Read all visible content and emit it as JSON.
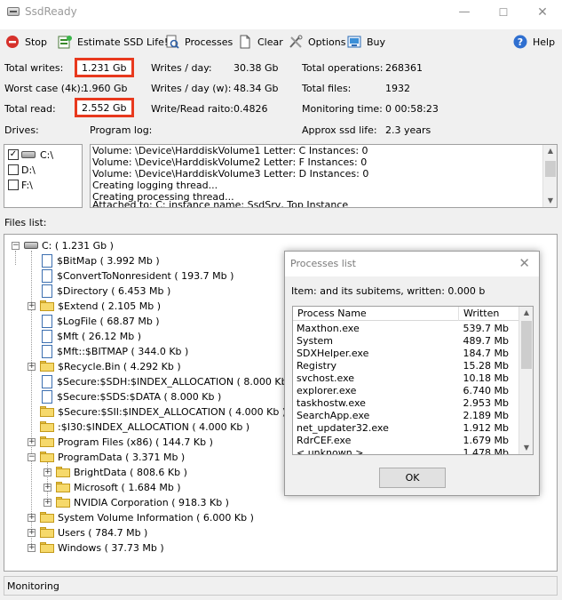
{
  "window": {
    "title": "SsdReady",
    "minimize": "—",
    "maximize": "☐",
    "close": "✕"
  },
  "toolbar": {
    "stop": "Stop",
    "estimate": "Estimate SSD Life!",
    "processes": "Processes",
    "clear": "Clear",
    "options": "Options",
    "buy": "Buy",
    "help": "Help"
  },
  "stats": {
    "total_writes_label": "Total writes:",
    "total_writes": "1.231 Gb",
    "worst_case_label": "Worst case (4k):",
    "worst_case": "1.960 Gb",
    "total_read_label": "Total read:",
    "total_read": "2.552 Gb",
    "writes_day_label": "Writes / day:",
    "writes_day": "30.38 Gb",
    "writes_day_w_label": "Writes / day (w):",
    "writes_day_w": "48.34 Gb",
    "ratio_label": "Write/Read raito:",
    "ratio": "0.4826",
    "total_ops_label": "Total operations:",
    "total_ops": "268361",
    "total_files_label": "Total files:",
    "total_files": "1932",
    "monitoring_time_label": "Monitoring time:",
    "monitoring_time": "0 00:58:23",
    "ssd_life_label": "Approx ssd life:",
    "ssd_life": "2.3 years"
  },
  "drives": {
    "label": "Drives:",
    "items": [
      {
        "name": "C:\\",
        "checked": "✓"
      },
      {
        "name": "D:\\",
        "checked": ""
      },
      {
        "name": "F:\\",
        "checked": ""
      }
    ]
  },
  "log": {
    "label": "Program log:",
    "lines": [
      "Volume: \\Device\\HarddiskVolume1 Letter: C Instances: 0",
      "Volume: \\Device\\HarddiskVolume2 Letter: F Instances: 0",
      "Volume: \\Device\\HarddiskVolume3 Letter: D Instances: 0",
      "Creating logging thread...",
      "Creating processing thread...",
      "Attached to: C: instance name: SsdSrv, Top Instance"
    ]
  },
  "files": {
    "label": "Files list:",
    "items": [
      {
        "text": "C: ( 1.231 Gb )"
      },
      {
        "text": "$BitMap ( 3.992 Mb )"
      },
      {
        "text": "$ConvertToNonresident ( 193.7 Mb )"
      },
      {
        "text": "$Directory ( 6.453 Mb )"
      },
      {
        "text": "$Extend ( 2.105 Mb )"
      },
      {
        "text": "$LogFile ( 68.87 Mb )"
      },
      {
        "text": "$Mft ( 26.12 Mb )"
      },
      {
        "text": "$Mft::$BITMAP ( 344.0 Kb )"
      },
      {
        "text": "$Recycle.Bin ( 4.292 Kb )"
      },
      {
        "text": "$Secure:$SDH:$INDEX_ALLOCATION ( 8.000 Kb )"
      },
      {
        "text": "$Secure:$SDS:$DATA ( 8.000 Kb )"
      },
      {
        "text": "$Secure:$SII:$INDEX_ALLOCATION ( 4.000 Kb )"
      },
      {
        "text": ":$I30:$INDEX_ALLOCATION ( 4.000 Kb )"
      },
      {
        "text": "Program Files (x86) ( 144.7 Kb )"
      },
      {
        "text": "ProgramData ( 3.371 Mb )"
      },
      {
        "text": "BrightData ( 808.6 Kb )"
      },
      {
        "text": "Microsoft ( 1.684 Mb )"
      },
      {
        "text": "NVIDIA Corporation ( 918.3 Kb )"
      },
      {
        "text": "System Volume Information ( 6.000 Kb )"
      },
      {
        "text": "Users ( 784.7 Mb )"
      },
      {
        "text": "Windows ( 37.73 Mb )"
      }
    ]
  },
  "status": {
    "text": "Monitoring"
  },
  "dialog": {
    "title": "Processes list",
    "close": "✕",
    "item_info": "Item:  and its subitems, written: 0.000 b",
    "col_name": "Process Name",
    "col_written": "Written",
    "rows": [
      {
        "name": "Maxthon.exe",
        "written": "539.7 Mb"
      },
      {
        "name": "System",
        "written": "489.7 Mb"
      },
      {
        "name": "SDXHelper.exe",
        "written": "184.7 Mb"
      },
      {
        "name": "Registry",
        "written": "15.28 Mb"
      },
      {
        "name": "svchost.exe",
        "written": "10.18 Mb"
      },
      {
        "name": "explorer.exe",
        "written": "6.740 Mb"
      },
      {
        "name": "taskhostw.exe",
        "written": "2.953 Mb"
      },
      {
        "name": "SearchApp.exe",
        "written": "2.189 Mb"
      },
      {
        "name": "net_updater32.exe",
        "written": "1.912 Mb"
      },
      {
        "name": "RdrCEF.exe",
        "written": "1.679 Mb"
      },
      {
        "name": "< unknown >",
        "written": "1.478 Mb"
      }
    ],
    "ok": "OK"
  }
}
